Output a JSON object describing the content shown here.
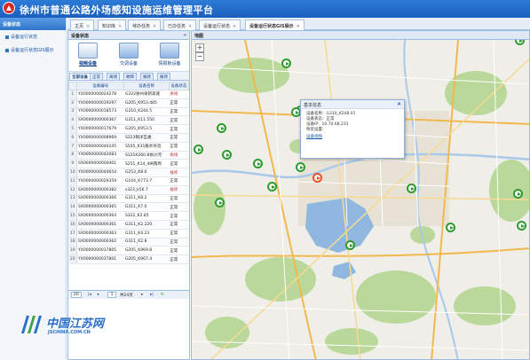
{
  "app": {
    "title": "徐州市普通公路外场感知设施运维管理平台"
  },
  "left_nav": {
    "header": "设备状态",
    "items": [
      {
        "label": "设备运行状态"
      },
      {
        "label": "设备运行状态GIS展示"
      }
    ]
  },
  "tabs": [
    {
      "label": "主页",
      "close": "×"
    },
    {
      "label": "知识库",
      "close": "×"
    },
    {
      "label": "待办任务",
      "close": "×"
    },
    {
      "label": "已办任务",
      "close": "×"
    },
    {
      "label": "设备运行状态",
      "close": "×"
    },
    {
      "label": "设备运行状态GIS展示",
      "close": "×"
    }
  ],
  "device_panel": {
    "title": "设备状态",
    "collapse": "«",
    "big_buttons": [
      {
        "label": "视频设备"
      },
      {
        "label": "交调设备"
      },
      {
        "label": "情报板设备"
      }
    ],
    "subtabs": [
      {
        "label": "全部设备"
      },
      {
        "label": "正常"
      },
      {
        "label": "离线"
      },
      {
        "label": "故障"
      },
      {
        "label": "报修"
      },
      {
        "label": "报停"
      }
    ],
    "columns": [
      "",
      "设备编号",
      "设备名称",
      "设备状态"
    ],
    "rows": [
      {
        "n": "1",
        "id": "YX0000000024278",
        "name": "G322徐州泉新高速",
        "status": "离线"
      },
      {
        "n": "2",
        "id": "YX0000000019297",
        "name": "G205_K953.485",
        "status": "正常"
      },
      {
        "n": "3",
        "id": "YX0000000018573",
        "name": "G310_K244.5",
        "status": "正常"
      },
      {
        "n": "4",
        "id": "SX0000000000367",
        "name": "G311_K11.550",
        "status": "正常"
      },
      {
        "n": "5",
        "id": "YX0000000017679",
        "name": "G205_K953.5",
        "status": "正常"
      },
      {
        "n": "6",
        "id": "YX0000000008969",
        "name": "S323铜沭互通",
        "status": "正常"
      },
      {
        "n": "7",
        "id": "YX0000000040245",
        "name": "S505_K31尾水导流",
        "status": "正常"
      },
      {
        "n": "8",
        "id": "YX0000000042083",
        "name": "S121K260.8徐沙河",
        "status": "离线"
      },
      {
        "n": "9",
        "id": "SX0000000000401",
        "name": "S251_K14_4闸南周",
        "status": "正常"
      },
      {
        "n": "10",
        "id": "YX0000000040654",
        "name": "G253_K8.0",
        "status": "报修"
      },
      {
        "n": "11",
        "id": "YX0000000029359",
        "name": "G104_K773.7",
        "status": "正常"
      },
      {
        "n": "12",
        "id": "SX0000000000382",
        "name": "s323_k56.7",
        "status": "报修"
      },
      {
        "n": "13",
        "id": "SX0000000000366",
        "name": "G311_K8.2",
        "status": "正常"
      },
      {
        "n": "14",
        "id": "SX0000000000365",
        "name": "G311_K7.0",
        "status": "正常"
      },
      {
        "n": "15",
        "id": "SX0000000000364",
        "name": "S322_K2.85",
        "status": "正常"
      },
      {
        "n": "16",
        "id": "SX0000000000361",
        "name": "G311_K2.220",
        "status": "正常"
      },
      {
        "n": "17",
        "id": "SX0000000000363",
        "name": "G311_K4.23",
        "status": "正常"
      },
      {
        "n": "18",
        "id": "SX0000000000362",
        "name": "G311_K2.8",
        "status": "正常"
      },
      {
        "n": "19",
        "id": "YX0000000037805",
        "name": "G205_K969.8",
        "status": "正常"
      },
      {
        "n": "20",
        "id": "YX0000000037801",
        "name": "G205_K967.4",
        "status": "正常"
      }
    ],
    "pager": {
      "page_size": "20",
      "page": "1",
      "total_pages": "共24页"
    }
  },
  "map": {
    "title": "地图",
    "zoom_in": "+",
    "zoom_out": "−",
    "popup": {
      "title": "基本信息",
      "close": "×",
      "lines": [
        "设备名称：G310_K248.01",
        "设备状态：正常",
        "设备IP：10.70.68.231",
        "附近设置："
      ],
      "link": "设备视频"
    }
  },
  "watermark": {
    "cn": "中国江苏网",
    "en": "JSCHINA.COM.CN"
  },
  "colors": {
    "header_blue": "#1a5fbd",
    "marker_green": "#2e9a2e",
    "marker_alert": "#e05522"
  }
}
